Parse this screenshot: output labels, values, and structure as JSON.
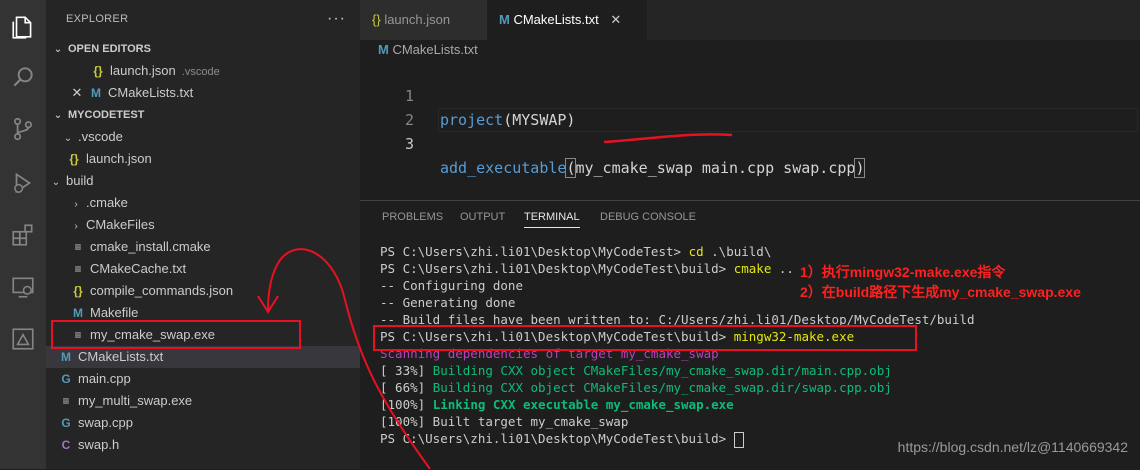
{
  "sidebar": {
    "title": "EXPLORER",
    "more": "···",
    "open_editors_label": "OPEN EDITORS",
    "open_editors": [
      {
        "name": "launch.json",
        "hint": ".vscode",
        "icon": "{}"
      },
      {
        "name": "CMakeLists.txt",
        "icon": "M"
      }
    ],
    "workspace_label": "MYCODETEST",
    "tree": [
      {
        "name": ".vscode",
        "icon": "chevron-down"
      },
      {
        "name": "launch.json",
        "icon": "{}"
      },
      {
        "name": "build",
        "icon": "chevron-down"
      },
      {
        "name": ".cmake",
        "icon": "chevron-right"
      },
      {
        "name": "CMakeFiles",
        "icon": "chevron-right"
      },
      {
        "name": "cmake_install.cmake",
        "icon": "≡"
      },
      {
        "name": "CMakeCache.txt",
        "icon": "≡"
      },
      {
        "name": "compile_commands.json",
        "icon": "{}"
      },
      {
        "name": "Makefile",
        "icon": "M"
      },
      {
        "name": "my_cmake_swap.exe",
        "icon": "≡"
      },
      {
        "name": "CMakeLists.txt",
        "icon": "M"
      },
      {
        "name": "main.cpp",
        "icon": "G"
      },
      {
        "name": "my_multi_swap.exe",
        "icon": "≡"
      },
      {
        "name": "swap.cpp",
        "icon": "G"
      },
      {
        "name": "swap.h",
        "icon": "C"
      }
    ]
  },
  "tabs": [
    {
      "label": "launch.json",
      "icon": "{}"
    },
    {
      "label": "CMakeLists.txt",
      "icon": "M",
      "close": "✕"
    }
  ],
  "breadcrumb": "CMakeLists.txt",
  "code": {
    "line_numbers": [
      "1",
      "2",
      "3"
    ],
    "line1_kw": "project",
    "line1_rest": "(MYSWAP)",
    "line3_kw": "add_executable",
    "line3_open": "(",
    "line3_rest": "my_cmake_swap main.cpp swap.cpp",
    "line3_close": ")"
  },
  "panel": {
    "tabs": [
      "PROBLEMS",
      "OUTPUT",
      "TERMINAL",
      "DEBUG CONSOLE"
    ],
    "active_tab": "TERMINAL",
    "lines": [
      {
        "prompt": "PS C:\\Users\\zhi.li01\\Desktop\\MyCodeTest> ",
        "cmd": "cd",
        "arg": " .\\build\\"
      },
      {
        "prompt": "PS C:\\Users\\zhi.li01\\Desktop\\MyCodeTest\\build> ",
        "cmd": "cmake",
        "arg": " .."
      },
      {
        "text": "-- Configuring done"
      },
      {
        "text": "-- Generating done"
      },
      {
        "text": "-- Build files have been written to: C:/Users/zhi.li01/Desktop/MyCodeTest/build"
      },
      {
        "prompt": "PS C:\\Users\\zhi.li01\\Desktop\\MyCodeTest\\build> ",
        "cmd": "mingw32-make.exe",
        "arg": ""
      },
      {
        "colored": "Scanning dependencies of target my_cmake_swap"
      },
      {
        "pre": "[ 33%] ",
        "colored": "Building CXX object CMakeFiles/my_cmake_swap.dir/main.cpp.obj"
      },
      {
        "pre": "[ 66%] ",
        "colored": "Building CXX object CMakeFiles/my_cmake_swap.dir/swap.cpp.obj"
      },
      {
        "pre": "[100%] ",
        "colored": "Linking CXX executable my_cmake_swap.exe"
      },
      {
        "text": "[100%] Built target my_cmake_swap"
      },
      {
        "prompt": "PS C:\\Users\\zhi.li01\\Desktop\\MyCodeTest\\build> ",
        "cmd": "",
        "arg": ""
      }
    ]
  },
  "annotations": {
    "note1": "1）执行mingw32-make.exe指令",
    "note2": "2）在build路径下生成my_cmake_swap.exe"
  },
  "watermark": "https://blog.csdn.net/lz@1140669342",
  "colors": {
    "activity_bar": "#333333",
    "sidebar": "#252526",
    "editor": "#1e1e1e",
    "annotation_red": "#e81123",
    "keyword_blue": "#569cd6"
  }
}
